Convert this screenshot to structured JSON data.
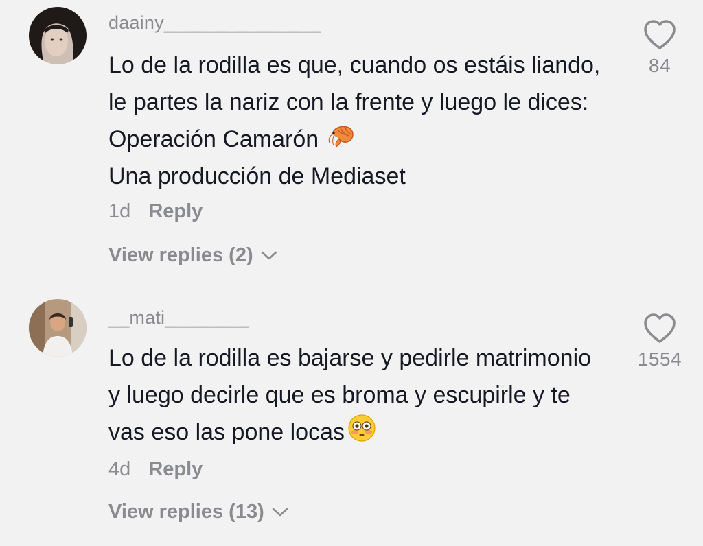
{
  "comments": [
    {
      "username": "daainy_______________",
      "text": "Lo de la rodilla es que, cuando os estáis liando, le partes la nariz con la frente y luego le dices: Operación Camarón",
      "text_line2": "Una producción de Mediaset",
      "emoji": "shrimp-emoji",
      "time": "1d",
      "reply_label": "Reply",
      "view_replies": "View replies (2)",
      "likes": "84"
    },
    {
      "username": "__mati________",
      "text": "Lo de la rodilla es bajarse y pedirle matrimonio y luego decirle que es broma y escupirle y te vas eso las pone locas",
      "emoji": "flushed-face-emoji",
      "time": "4d",
      "reply_label": "Reply",
      "view_replies": "View replies (13)",
      "likes": "1554"
    }
  ],
  "colors": {
    "background": "#f2f2f2",
    "text_primary": "#161823",
    "text_secondary": "#8a8b91"
  }
}
